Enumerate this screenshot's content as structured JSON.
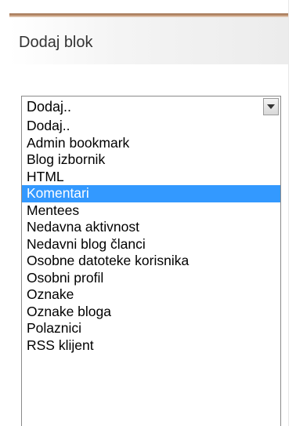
{
  "block": {
    "title": "Dodaj blok"
  },
  "select": {
    "value": "Dodaj..",
    "options": [
      "Dodaj..",
      "Admin bookmark",
      "Blog izbornik",
      "HTML",
      "Komentari",
      "Mentees",
      "Nedavna aktivnost",
      "Nedavni blog članci",
      "Osobne datoteke korisnika",
      "Osobni profil",
      "Oznake",
      "Oznake bloga",
      "Polaznici",
      "RSS klijent"
    ],
    "highlighted": "Komentari"
  },
  "colors": {
    "highlight": "#3399ff",
    "top_rule": "#9b6f4f"
  }
}
